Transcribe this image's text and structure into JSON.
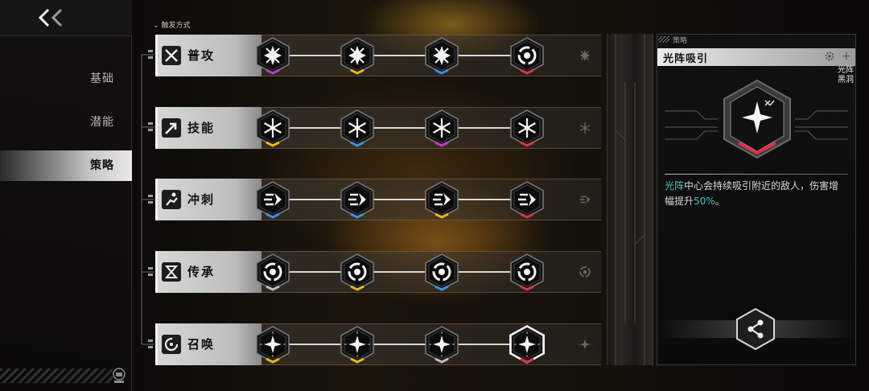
{
  "nav": {
    "back_icon": "double-chevron-left-icon",
    "items": [
      {
        "label": "基础",
        "active": false
      },
      {
        "label": "潜能",
        "active": false
      },
      {
        "label": "策略",
        "active": true
      }
    ],
    "badge_icon": "gamepad-badge-icon"
  },
  "trigger_header": "触发方式",
  "rows": [
    {
      "label": "普攻",
      "icon": "crossed-swords-icon",
      "nodes": [
        {
          "icon": "shuriken-icon",
          "accent": "#c03ad0"
        },
        {
          "icon": "shuriken-icon",
          "accent": "#e6b81c"
        },
        {
          "icon": "shuriken-icon",
          "accent": "#3b8ee6"
        },
        {
          "icon": "vortex-icon",
          "accent": "#e0304a"
        }
      ]
    },
    {
      "label": "技能",
      "icon": "arrow-burst-icon",
      "nodes": [
        {
          "icon": "snowflake-icon",
          "accent": "#e6b81c"
        },
        {
          "icon": "snowflake-icon",
          "accent": "#3b8ee6"
        },
        {
          "icon": "snowflake-icon",
          "accent": "#c03ad0"
        },
        {
          "icon": "snowflake-icon",
          "accent": "#e0304a"
        }
      ]
    },
    {
      "label": "冲刺",
      "icon": "dash-runner-icon",
      "nodes": [
        {
          "icon": "dash-wing-icon",
          "accent": "#3b8ee6"
        },
        {
          "icon": "dash-wing-icon",
          "accent": "#3b8ee6"
        },
        {
          "icon": "dash-wing-icon",
          "accent": "#e6b81c"
        },
        {
          "icon": "dash-wing-icon",
          "accent": "#e0304a"
        }
      ]
    },
    {
      "label": "传承",
      "icon": "hourglass-icon",
      "nodes": [
        {
          "icon": "vortex-icon",
          "accent": "#bdbdbd"
        },
        {
          "icon": "vortex-icon",
          "accent": "#e6b81c"
        },
        {
          "icon": "vortex-icon",
          "accent": "#3b8ee6"
        },
        {
          "icon": "vortex-icon",
          "accent": "#e0304a"
        }
      ]
    },
    {
      "label": "召唤",
      "icon": "summon-circle-icon",
      "nodes": [
        {
          "icon": "sparkle-star-icon",
          "accent": "#e6b81c"
        },
        {
          "icon": "sparkle-star-icon",
          "accent": "#e6b81c"
        },
        {
          "icon": "sparkle-star-icon",
          "accent": "#bdbdbd"
        },
        {
          "icon": "sparkle-star-icon",
          "accent": "#e0304a",
          "selected": true
        }
      ]
    }
  ],
  "panel": {
    "tab": "策略",
    "title": "光阵吸引",
    "tag_line1": "光阵",
    "tag_line2": "黑洞",
    "desc_highlight": "光阵",
    "desc_main": "中心会持续吸引附近的敌人，伤害增幅提升",
    "desc_value": "50%",
    "desc_end": "。",
    "gear_icon": "gear-icon",
    "share_icon": "share-icon"
  },
  "colors": {
    "highlight": "#3fc7c0",
    "red": "#e0304a",
    "gold": "#e6b81c",
    "blue": "#3b8ee6",
    "purple": "#c03ad0"
  }
}
